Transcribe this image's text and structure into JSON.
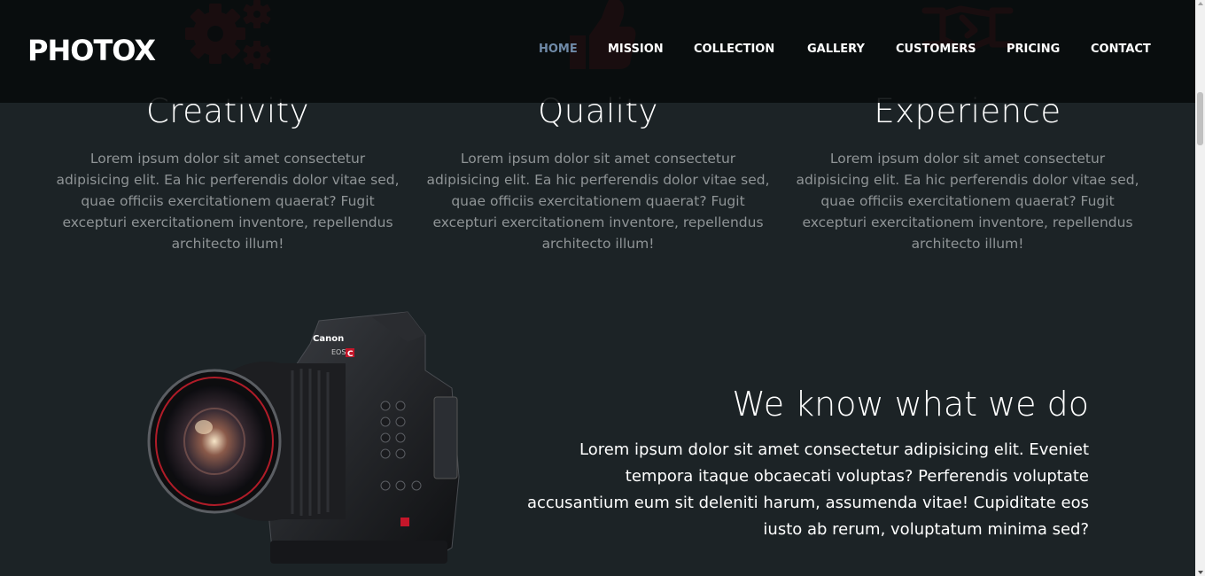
{
  "brand": {
    "logo": "PHOTOX"
  },
  "nav": {
    "active_color": "#6f8aa8",
    "items": [
      {
        "label": "HOME",
        "active": true
      },
      {
        "label": "MISSION",
        "active": false
      },
      {
        "label": "COLLECTION",
        "active": false
      },
      {
        "label": "GALLERY",
        "active": false
      },
      {
        "label": "CUSTOMERS",
        "active": false
      },
      {
        "label": "PRICING",
        "active": false
      },
      {
        "label": "CONTACT",
        "active": false
      }
    ]
  },
  "features": [
    {
      "icon": "gears-icon",
      "title": "Creativity",
      "text": "Lorem ipsum dolor sit amet consectetur adipisicing elit. Ea hic perferendis dolor vitae sed, quae officiis exercitationem quaerat? Fugit excepturi exercitationem inventore, repellendus architecto illum!"
    },
    {
      "icon": "thumbs-up-icon",
      "title": "Quality",
      "text": "Lorem ipsum dolor sit amet consectetur adipisicing elit. Ea hic perferendis dolor vitae sed, quae officiis exercitationem quaerat? Fugit excepturi exercitationem inventore, repellendus architecto illum!"
    },
    {
      "icon": "handshake-icon",
      "title": "Experience",
      "text": "Lorem ipsum dolor sit amet consectetur adipisicing elit. Ea hic perferendis dolor vitae sed, quae officiis exercitationem quaerat? Fugit excepturi exercitationem inventore, repellendus architecto illum!"
    }
  ],
  "about": {
    "title": "We know what we do",
    "text": "Lorem ipsum dolor sit amet consectetur adipisicing elit. Eveniet tempora itaque obcaecati voluptas? Perferendis voluptate accusantium eum sit deleniti harum, assumenda vitae! Cupiditate eos iusto ab rerum, voluptatum minima sed?",
    "camera_labels": {
      "brand": "Canon",
      "model": "EOS",
      "badge": "C"
    }
  },
  "colors": {
    "accent_red": "#b5252e",
    "background": "#1c2326",
    "nav_background": "#0a0d0e"
  }
}
